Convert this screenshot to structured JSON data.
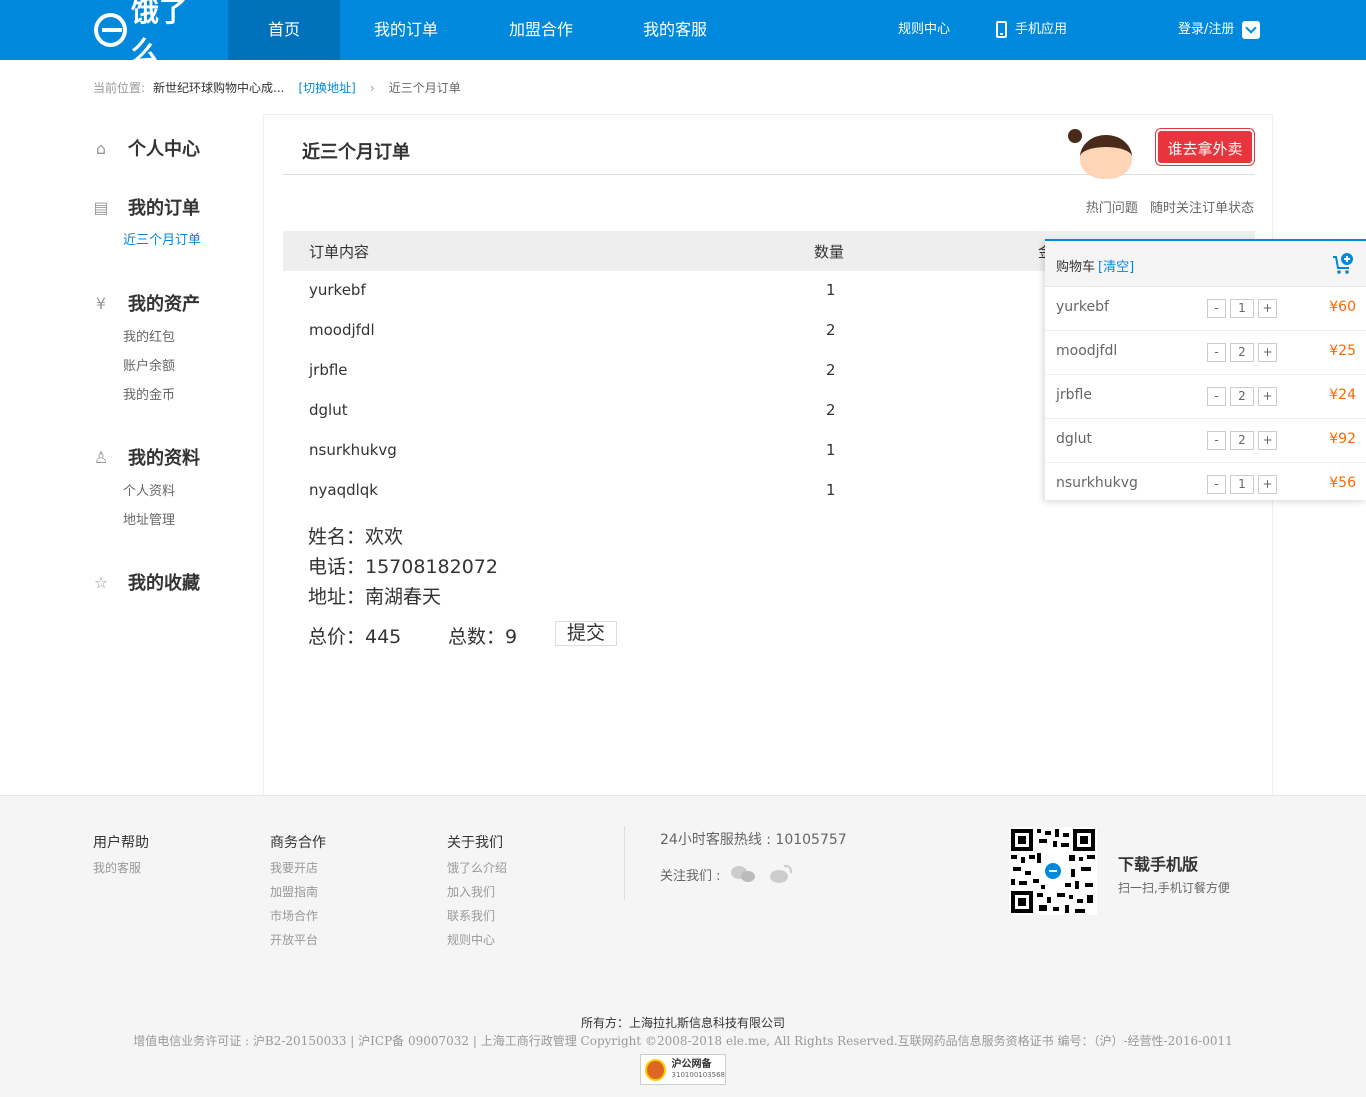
{
  "header": {
    "logo": "饿了么",
    "nav": [
      {
        "label": "首页",
        "active": true
      },
      {
        "label": "我的订单",
        "active": false
      },
      {
        "label": "加盟合作",
        "active": false
      },
      {
        "label": "我的客服",
        "active": false
      }
    ],
    "rules": "规则中心",
    "mobile_app": "手机应用",
    "login": "登录/注册",
    "accent": "#0089dc"
  },
  "breadcrumb": {
    "label": "当前位置:",
    "address": "新世纪环球购物中心成...",
    "switch": "[切换地址]",
    "sep": "›",
    "current": "近三个月订单"
  },
  "sidebar": {
    "groups": [
      {
        "icon": "home-icon",
        "title": "个人中心",
        "items": []
      },
      {
        "icon": "document-icon",
        "title": "我的订单",
        "items": [
          {
            "label": "近三个月订单",
            "active": true
          }
        ]
      },
      {
        "icon": "yen-icon",
        "title": "我的资产",
        "items": [
          {
            "label": "我的红包"
          },
          {
            "label": "账户余额"
          },
          {
            "label": "我的金币"
          }
        ]
      },
      {
        "icon": "user-icon",
        "title": "我的资料",
        "items": [
          {
            "label": "个人资料"
          },
          {
            "label": "地址管理"
          }
        ]
      },
      {
        "icon": "star-icon",
        "title": "我的收藏",
        "items": []
      }
    ]
  },
  "main": {
    "title": "近三个月订单",
    "banner": "谁去拿外卖",
    "quick_links": [
      "热门问题",
      "随时关注订单状态"
    ],
    "table": {
      "headers": [
        "订单内容",
        "数量",
        "金"
      ],
      "rows": [
        {
          "name": "yurkebf",
          "qty": "1"
        },
        {
          "name": "moodjfdl",
          "qty": "2"
        },
        {
          "name": "jrbfle",
          "qty": "2"
        },
        {
          "name": "dglut",
          "qty": "2"
        },
        {
          "name": "nsurkhukvg",
          "qty": "1"
        },
        {
          "name": "nyaqdlqk",
          "qty": "1"
        }
      ]
    },
    "contact": {
      "name": "姓名：欢欢",
      "phone": "电话：15708182072",
      "address": "地址：南湖春天"
    },
    "total_price": "总价：445",
    "total_count": "总数：9",
    "submit": "提交"
  },
  "cart": {
    "title": "购物车",
    "clear": "[清空]",
    "items": [
      {
        "name": "yurkebf",
        "qty": "1",
        "price": "¥60"
      },
      {
        "name": "moodjfdl",
        "qty": "2",
        "price": "¥25"
      },
      {
        "name": "jrbfle",
        "qty": "2",
        "price": "¥24"
      },
      {
        "name": "dglut",
        "qty": "2",
        "price": "¥92"
      },
      {
        "name": "nsurkhukvg",
        "qty": "1",
        "price": "¥56"
      }
    ],
    "minus": "-",
    "plus": "+",
    "price_color": "#ff6600"
  },
  "footer": {
    "columns": [
      {
        "title": "用户帮助",
        "items": [
          "我的客服"
        ]
      },
      {
        "title": "商务合作",
        "items": [
          "我要开店",
          "加盟指南",
          "市场合作",
          "开放平台"
        ]
      },
      {
        "title": "关于我们",
        "items": [
          "饿了么介绍",
          "加入我们",
          "联系我们",
          "规则中心"
        ]
      }
    ],
    "hotline": "24小时客服热线 : 10105757",
    "follow": "关注我们 :",
    "download_title": "下载手机版",
    "download_sub": "扫一扫,手机订餐方便",
    "owner": "所有方：上海拉扎斯信息科技有限公司",
    "license": "增值电信业务许可证 : 沪B2-20150033 | 沪ICP备 09007032 | 上海工商行政管理 Copyright ©2008-2018 ele.me, All Rights Reserved.互联网药品信息服务资格证书 编号：（沪）-经营性-2016-0011",
    "badge_title": "沪公网备",
    "badge_num": "310100103568"
  }
}
